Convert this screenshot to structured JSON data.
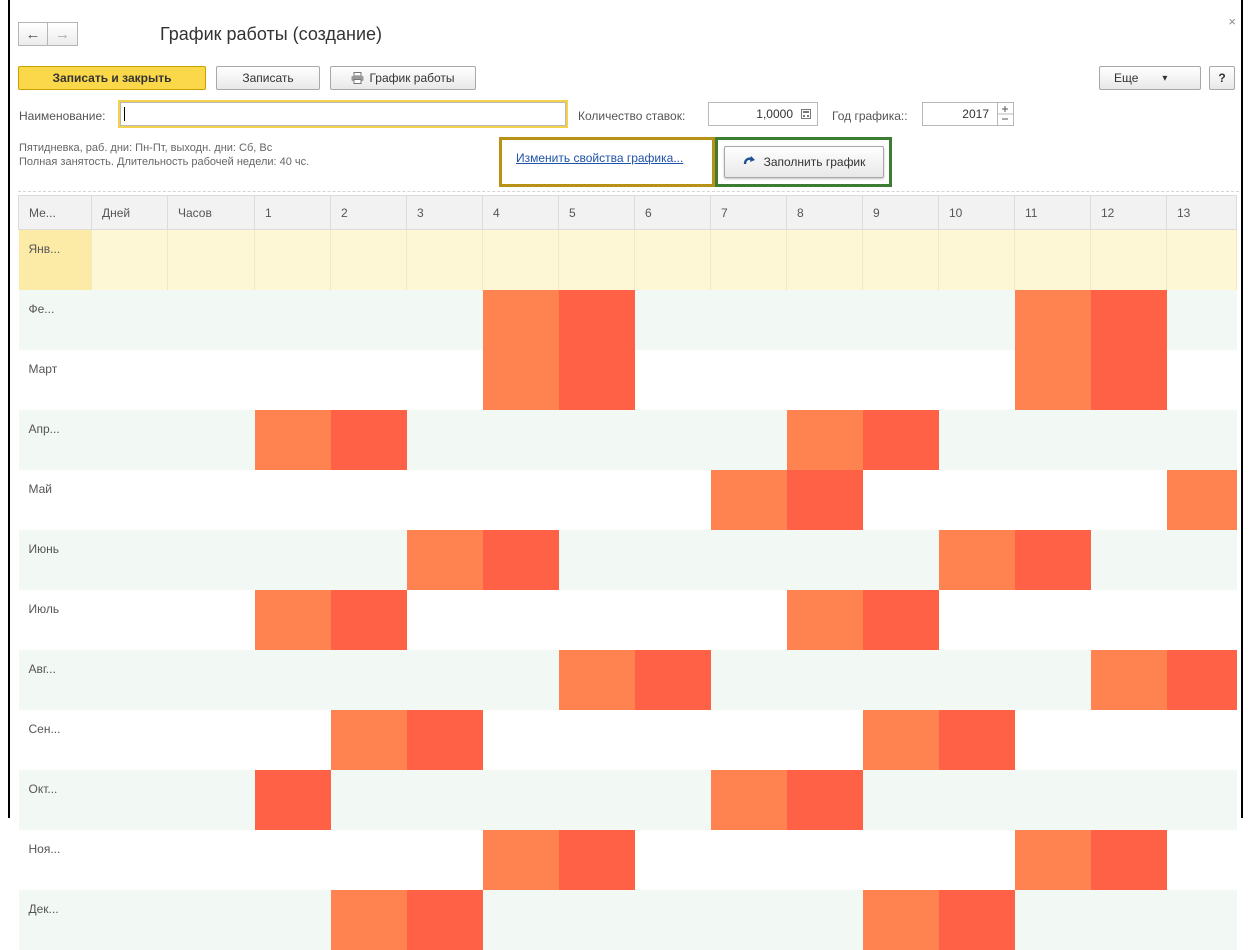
{
  "window": {
    "title": "График работы (создание)",
    "close_glyph": "×"
  },
  "nav": {
    "back_glyph": "←",
    "forward_glyph": "→"
  },
  "toolbar": {
    "save_close": "Записать и закрыть",
    "save": "Записать",
    "print_icon": "printer-icon",
    "print_label": "График работы",
    "more": "Еще",
    "more_arrow": "▾",
    "help": "?"
  },
  "form": {
    "name_label": "Наименование:",
    "name_value": "",
    "rate_label": "Количество ставок:",
    "rate_value": "1,0000",
    "year_label": "Год графика::",
    "year_value": "2017",
    "hint_line1": "Пятидневка, раб. дни: Пн-Пт, выходн. дни: Сб, Вс",
    "hint_line2": "Полная занятость. Длительность рабочей недели: 40 чс.",
    "change_link": "Изменить свойства графика...",
    "fill_button": "Заполнить график",
    "fill_icon": "refresh-arrow-icon"
  },
  "colors": {
    "weekend_sat": "#ff8350",
    "weekend_sun": "#ff6147",
    "row_alt": "#f2f8f3",
    "selected_row": "#fdf7d5",
    "primary_button": "#fbd74a"
  },
  "table": {
    "headers": [
      "Ме...",
      "Дней",
      "Часов",
      "1",
      "2",
      "3",
      "4",
      "5",
      "6",
      "7",
      "8",
      "9",
      "10",
      "11",
      "12",
      "13"
    ],
    "rows": [
      {
        "month": "Янв...",
        "marks": ""
      },
      {
        "month": "Фе...",
        "marks": "---or-----or-"
      },
      {
        "month": "Март",
        "marks": "---or-----or-"
      },
      {
        "month": "Апр...",
        "marks": "or-----or----"
      },
      {
        "month": "Май",
        "marks": "------or----o"
      },
      {
        "month": "Июнь",
        "marks": "--or-----or--"
      },
      {
        "month": "Июль",
        "marks": "or-----or----"
      },
      {
        "month": "Авг...",
        "marks": "----or-----or"
      },
      {
        "month": "Сен...",
        "marks": "-or-----or---"
      },
      {
        "month": "Окт...",
        "marks": "r-----or-----"
      },
      {
        "month": "Ноя...",
        "marks": "---or-----or-"
      },
      {
        "month": "Дек...",
        "marks": "-or-----or---"
      }
    ]
  }
}
